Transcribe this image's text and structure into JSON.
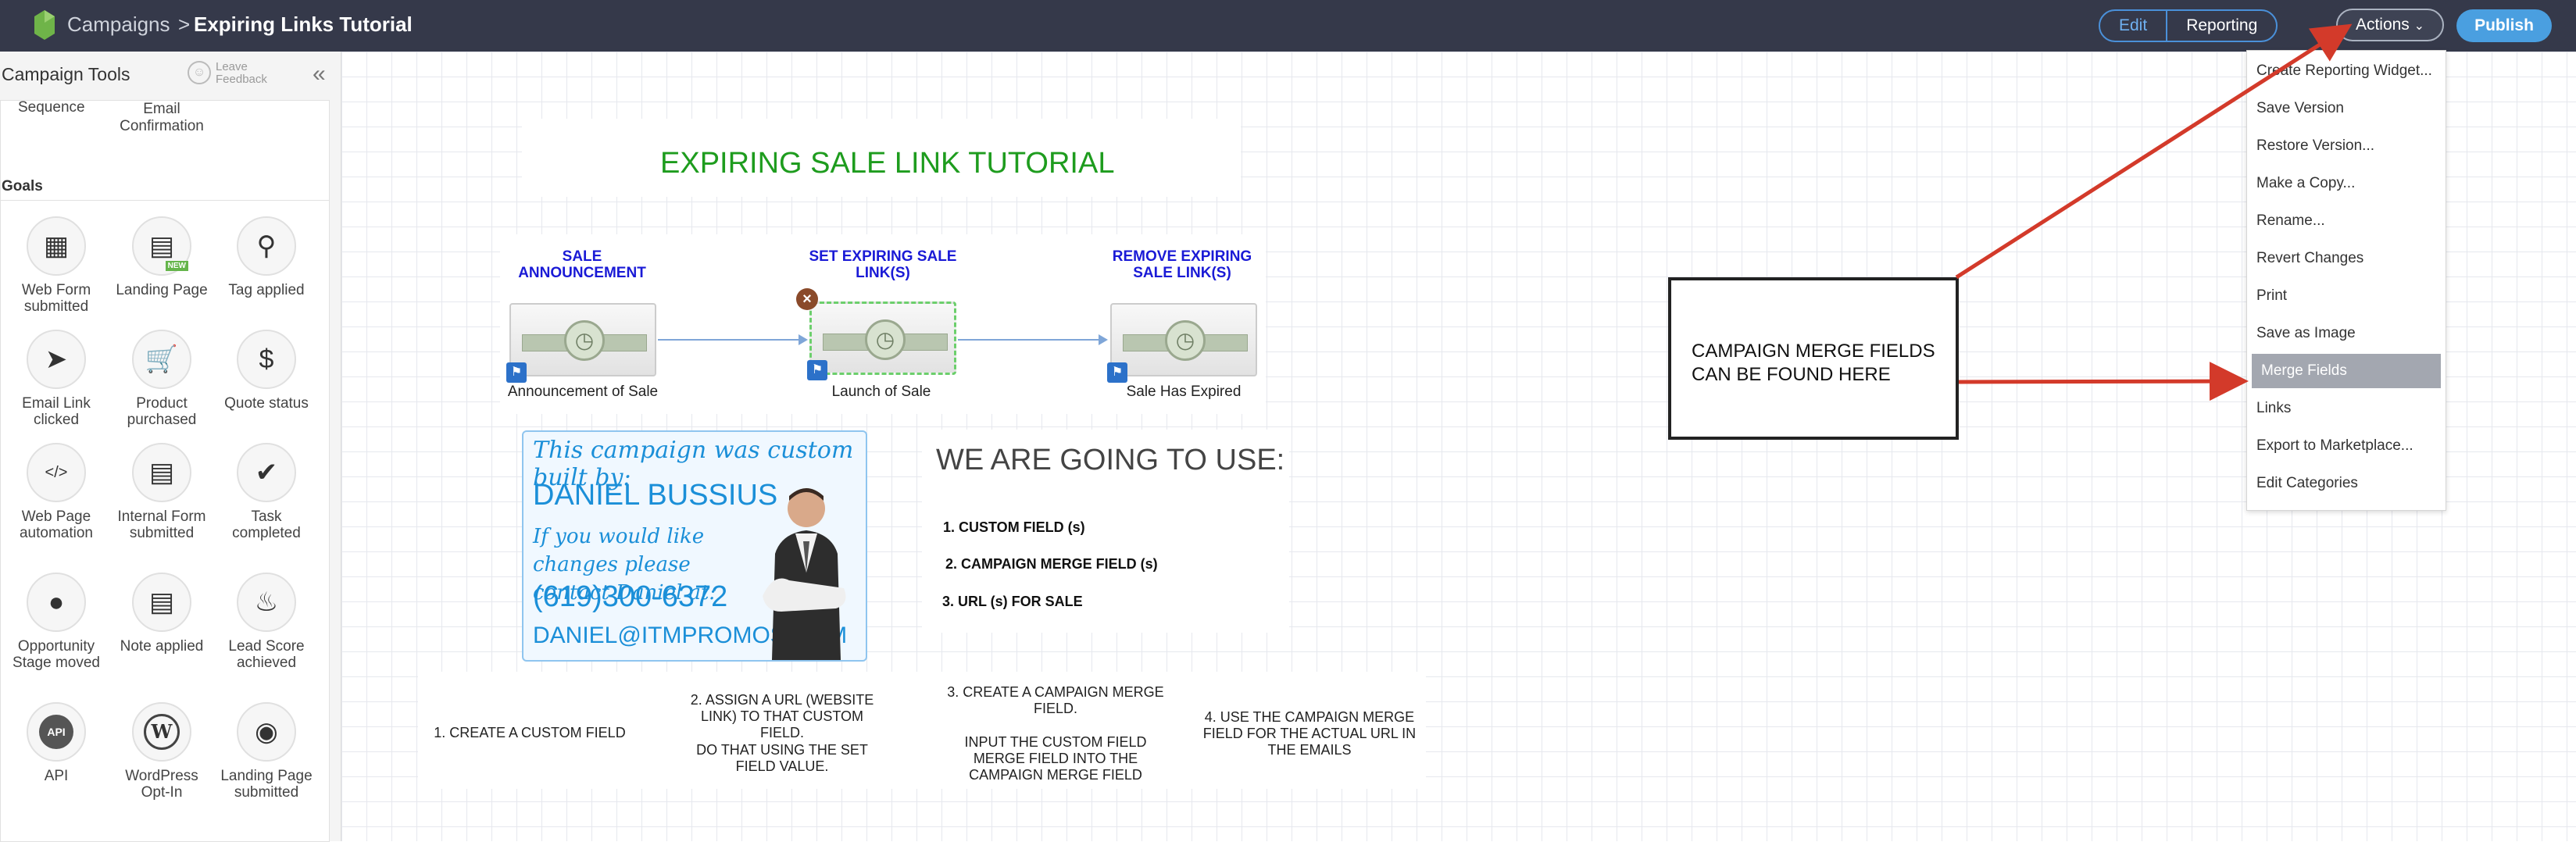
{
  "header": {
    "breadcrumb_root": "Campaigns",
    "separator": ">",
    "title": "Expiring Links Tutorial",
    "tabs": [
      {
        "label": "Edit"
      },
      {
        "label": "Reporting"
      }
    ],
    "actions_label": "Actions",
    "publish_label": "Publish"
  },
  "sidebar": {
    "title": "Campaign Tools",
    "feedback": "Leave Feedback",
    "sequence_items": [
      "Sequence",
      "Email Confirmation"
    ],
    "goals_heading": "Goals",
    "goals": [
      {
        "label": "Web Form submitted",
        "icon": "web-form-icon"
      },
      {
        "label": "Landing Page",
        "icon": "landing-page-icon",
        "badge": "NEW"
      },
      {
        "label": "Tag applied",
        "icon": "tag-icon"
      },
      {
        "label": "Email Link clicked",
        "icon": "cursor-icon"
      },
      {
        "label": "Product purchased",
        "icon": "cart-icon"
      },
      {
        "label": "Quote status",
        "icon": "dollar-icon"
      },
      {
        "label": "Web Page automation",
        "icon": "code-icon"
      },
      {
        "label": "Internal Form submitted",
        "icon": "form-icon"
      },
      {
        "label": "Task completed",
        "icon": "check-icon"
      },
      {
        "label": "Opportunity Stage moved",
        "icon": "opportunity-icon"
      },
      {
        "label": "Note applied",
        "icon": "note-icon"
      },
      {
        "label": "Lead Score achieved",
        "icon": "fire-icon"
      },
      {
        "label": "API",
        "icon": "api-icon"
      },
      {
        "label": "WordPress Opt-In",
        "icon": "wordpress-icon"
      },
      {
        "label": "Landing Page submitted",
        "icon": "landing-submit-icon"
      }
    ]
  },
  "canvas": {
    "heading": "EXPIRING SALE LINK TUTORIAL",
    "steps": [
      {
        "name": "SALE ANNOUNCEMENT",
        "label": "Announcement of Sale"
      },
      {
        "name": "SET EXPIRING SALE LINK(S)",
        "label": "Launch of Sale"
      },
      {
        "name": "REMOVE EXPIRING SALE LINK(S)",
        "label": "Sale Has Expired"
      }
    ],
    "card": {
      "line1": "This campaign was custom built by:",
      "line2": "DANIEL BUSSIUS",
      "line3": "If you would like changes please contact Daniel at:",
      "line4": "(619)300-6372",
      "line5": "DANIEL@ITMPROMOS.COM"
    },
    "use_heading": "WE ARE GOING TO USE:",
    "use_items": [
      "1. CUSTOM FIELD (s)",
      "2. CAMPAIGN MERGE FIELD (s)",
      "3. URL (s) FOR SALE"
    ],
    "notes": [
      "1. CREATE A CUSTOM FIELD",
      "2. ASSIGN A URL (WEBSITE LINK) TO THAT CUSTOM FIELD.",
      "DO THAT USING THE SET FIELD VALUE.",
      "3. CREATE A CAMPAIGN MERGE FIELD.",
      "INPUT THE CUSTOM FIELD MERGE FIELD INTO THE CAMPAIGN MERGE FIELD",
      "4. USE THE CAMPAIGN MERGE FIELD FOR THE ACTUAL URL IN THE EMAILS"
    ],
    "callout": "CAMPAIGN MERGE FIELDS CAN BE FOUND HERE"
  },
  "actions_menu": {
    "items": [
      "Create Reporting Widget...",
      "Save Version",
      "Restore Version...",
      "Make a Copy...",
      "Rename...",
      "Revert Changes",
      "Print",
      "Save as Image",
      "Merge Fields",
      "Links",
      "Export to Marketplace...",
      "Edit Categories"
    ],
    "highlighted": "Merge Fields"
  },
  "colors": {
    "topbar": "#35394a",
    "accent": "#4a9fe0",
    "heading_green": "#1e9c1e",
    "step_blue": "#1a1ad6",
    "arrow_red": "#d33a2a"
  }
}
